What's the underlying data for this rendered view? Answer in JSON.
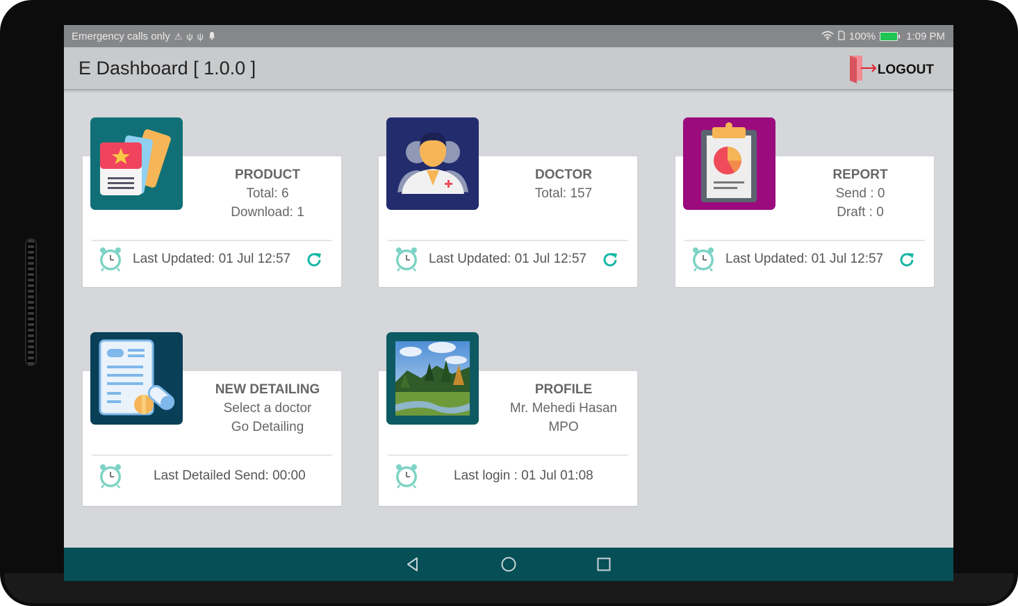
{
  "status_bar": {
    "carrier": "Emergency calls only",
    "battery": "100%",
    "time": "1:09 PM",
    "icons": [
      "warning-icon",
      "usb-icon",
      "usb-icon",
      "notification-icon",
      "wifi-icon",
      "sim-icon",
      "battery-charging-icon"
    ]
  },
  "appbar": {
    "title": "E Dashboard [ 1.0.0 ]",
    "logout_label": "LOGOUT",
    "logout_icon": "exit-door-icon"
  },
  "cards": {
    "product": {
      "title": "PRODUCT",
      "line1": "Total: 6",
      "line2": "Download: 1",
      "footer": "Last Updated: 01 Jul 12:57",
      "tile_color": "#117077",
      "icon": "product-cards-icon"
    },
    "doctor": {
      "title": "DOCTOR",
      "line1": "Total: 157",
      "line2": "",
      "footer": "Last Updated: 01 Jul 12:57",
      "tile_color": "#232c6d",
      "icon": "doctor-icon"
    },
    "report": {
      "title": "REPORT",
      "line1": "Send : 0",
      "line2": "Draft : 0",
      "footer": "Last Updated: 01 Jul 12:57",
      "tile_color": "#9b0b7e",
      "icon": "report-clipboard-icon"
    },
    "detailing": {
      "title": "NEW DETAILING",
      "line1": "Select a doctor",
      "line2": "Go Detailing",
      "footer": "Last Detailed Send: 00:00",
      "tile_color": "#093f57",
      "icon": "prescription-pills-icon"
    },
    "profile": {
      "title": "PROFILE",
      "line1": "Mr. Mehedi Hasan",
      "line2": "MPO",
      "footer": "Last login : 01 Jul 01:08",
      "tile_color": "#0e5a62",
      "icon": "landscape-photo-icon"
    }
  },
  "colors": {
    "accent_refresh": "#17b7a4",
    "navbar": "#064f57",
    "background": "#d5d7da"
  },
  "nav": {
    "icons": [
      "back-icon",
      "home-icon",
      "recents-icon"
    ]
  }
}
